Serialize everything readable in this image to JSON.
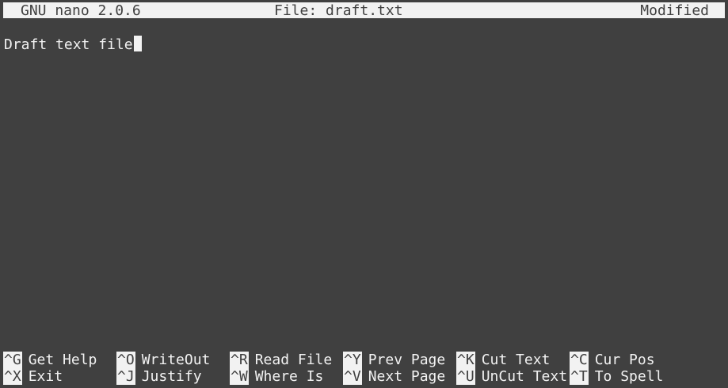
{
  "titlebar": {
    "app": "GNU nano 2.0.6",
    "file": "File: draft.txt",
    "status": "Modified"
  },
  "buffer": {
    "text": "Draft text file"
  },
  "shortcuts": [
    {
      "key": "^G",
      "label": "Get Help"
    },
    {
      "key": "^O",
      "label": "WriteOut"
    },
    {
      "key": "^R",
      "label": "Read File"
    },
    {
      "key": "^Y",
      "label": "Prev Page"
    },
    {
      "key": "^K",
      "label": "Cut Text"
    },
    {
      "key": "^C",
      "label": "Cur Pos"
    },
    {
      "key": "^X",
      "label": "Exit"
    },
    {
      "key": "^J",
      "label": "Justify"
    },
    {
      "key": "^W",
      "label": "Where Is"
    },
    {
      "key": "^V",
      "label": "Next Page"
    },
    {
      "key": "^U",
      "label": "UnCut Text"
    },
    {
      "key": "^T",
      "label": "To Spell"
    }
  ]
}
